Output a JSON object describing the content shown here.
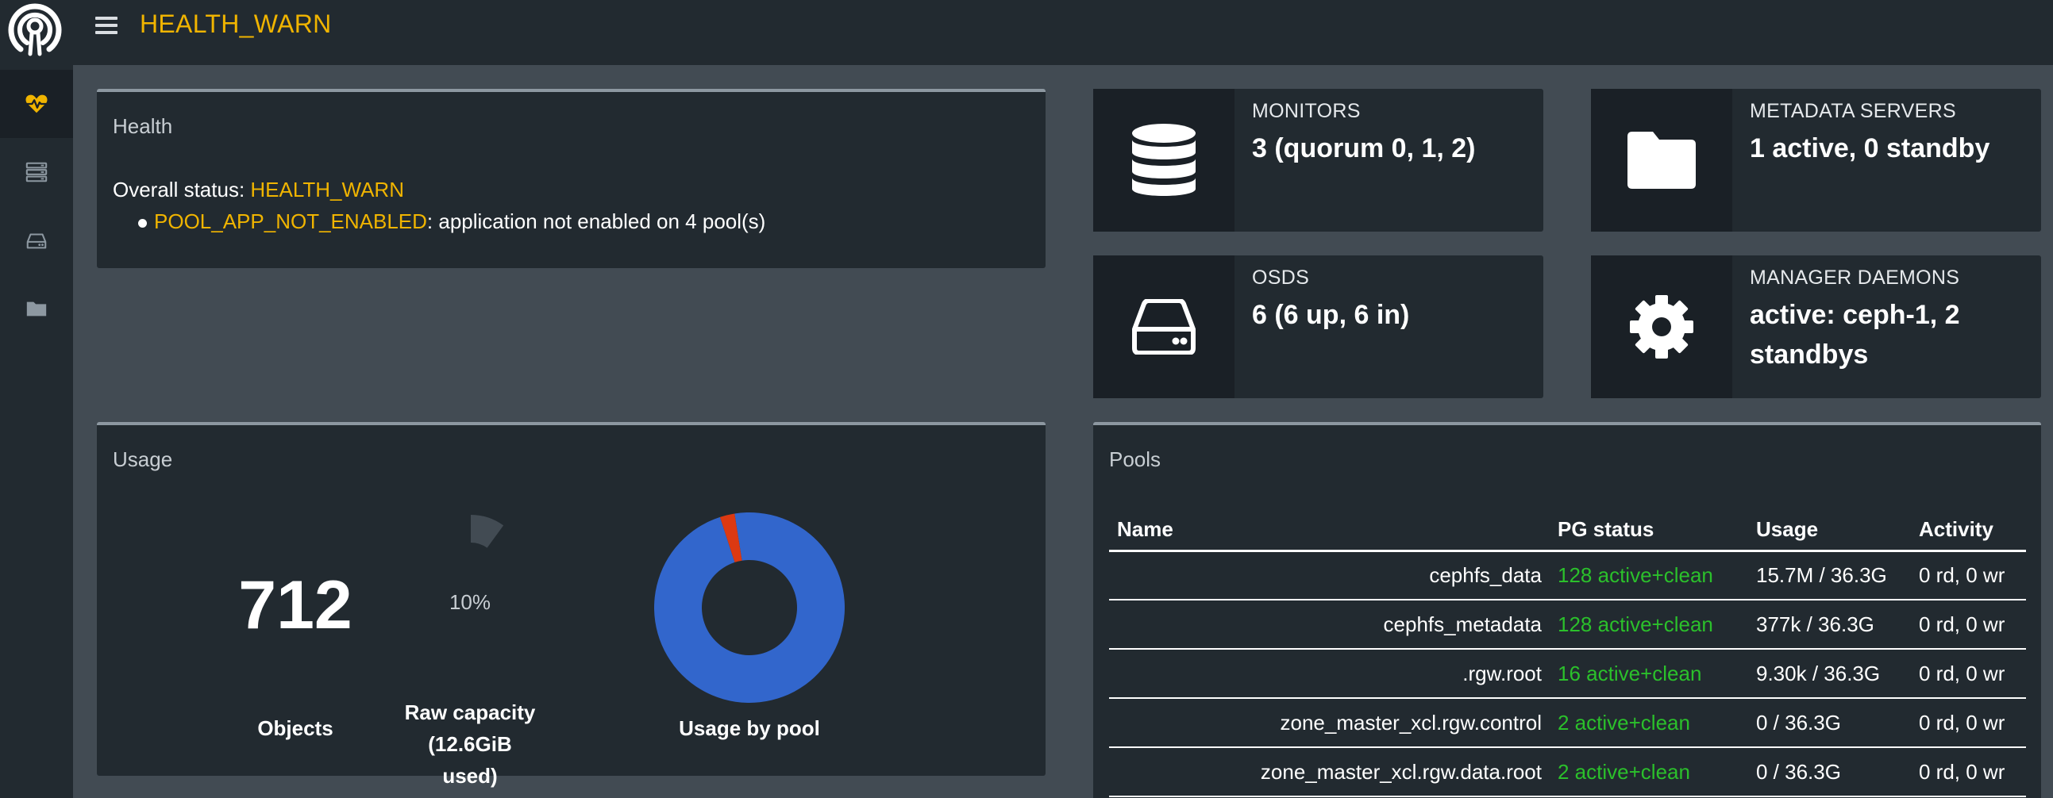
{
  "header": {
    "status": "HEALTH_WARN"
  },
  "sidebar": {
    "items": [
      {
        "icon": "heartbeat-icon",
        "active": true
      },
      {
        "icon": "server-list-icon",
        "active": false
      },
      {
        "icon": "hdd-icon",
        "active": false
      },
      {
        "icon": "folder-icon",
        "active": false
      }
    ]
  },
  "health": {
    "title": "Health",
    "overall_label": "Overall status: ",
    "overall_value": "HEALTH_WARN",
    "check_code": "POOL_APP_NOT_ENABLED",
    "check_message": ": application not enabled on 4 pool(s)"
  },
  "tiles": {
    "monitors": {
      "label": "MONITORS",
      "value": "3 (quorum 0, 1, 2)"
    },
    "metadata": {
      "label": "METADATA SERVERS",
      "value": "1 active, 0 standby"
    },
    "osds": {
      "label": "OSDS",
      "value": "6 (6 up, 6 in)"
    },
    "managers": {
      "label": "MANAGER DAEMONS",
      "value": "active: ceph-1, 2 standbys"
    }
  },
  "usage": {
    "title": "Usage",
    "objects_value": "712",
    "objects_label": "Objects",
    "raw_capacity_percent": "10%",
    "raw_capacity_fraction": 0.1,
    "raw_capacity_label_line1": "Raw capacity",
    "raw_capacity_label_line2": "(12.6GiB used)",
    "usage_by_pool_label": "Usage by pool"
  },
  "chart_data": {
    "type": "pie",
    "title": "Usage by pool",
    "slices": [
      {
        "name": "",
        "value": 97.5,
        "color": "#3266cc"
      },
      {
        "name": "",
        "value": 2.5,
        "color": "#dc3912"
      }
    ]
  },
  "pools": {
    "title": "Pools",
    "columns": [
      "Name",
      "PG status",
      "Usage",
      "Activity"
    ],
    "rows": [
      {
        "name": "cephfs_data",
        "pg": "128 active+clean",
        "usage": "15.7M / 36.3G",
        "activity": "0 rd, 0 wr"
      },
      {
        "name": "cephfs_metadata",
        "pg": "128 active+clean",
        "usage": "377k / 36.3G",
        "activity": "0 rd, 0 wr"
      },
      {
        "name": ".rgw.root",
        "pg": "16 active+clean",
        "usage": "9.30k / 36.3G",
        "activity": "0 rd, 0 wr"
      },
      {
        "name": "zone_master_xcl.rgw.control",
        "pg": "2 active+clean",
        "usage": "0 / 36.3G",
        "activity": "0 rd, 0 wr"
      },
      {
        "name": "zone_master_xcl.rgw.data.root",
        "pg": "2 active+clean",
        "usage": "0 / 36.3G",
        "activity": "0 rd, 0 wr"
      }
    ]
  }
}
